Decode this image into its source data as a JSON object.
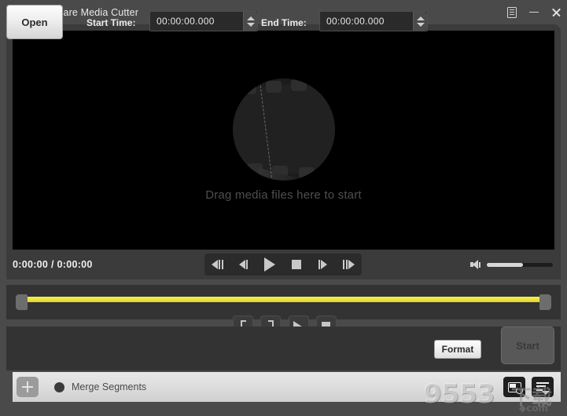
{
  "window": {
    "title": "Joyoshare Media Cutter",
    "logo_icon": "app-logo-icon",
    "menu_icon": "menu-icon",
    "minimize_icon": "minimize-icon",
    "close_icon": "close-icon"
  },
  "player": {
    "drop_hint": "Drag media files here to start",
    "placeholder_icon": "film-reel-icon",
    "time_display": "0:00:00 / 0:00:00",
    "transport": [
      {
        "name": "step-back-fast-button",
        "icon": "skip-back-frames-icon"
      },
      {
        "name": "step-back-button",
        "icon": "step-back-icon"
      },
      {
        "name": "play-button",
        "icon": "play-icon"
      },
      {
        "name": "stop-button",
        "icon": "stop-icon"
      },
      {
        "name": "step-forward-button",
        "icon": "step-forward-icon"
      },
      {
        "name": "step-forward-fast-button",
        "icon": "skip-forward-frames-icon"
      }
    ],
    "volume": {
      "icon": "speaker-icon",
      "level_percent": 55
    }
  },
  "timeline": {
    "left_handle": "trim-start-handle",
    "right_handle": "trim-end-handle",
    "track_color": "#efe33f"
  },
  "trim_controls": [
    {
      "name": "set-start-point-button",
      "icon": "bracket-left-icon"
    },
    {
      "name": "set-end-point-button",
      "icon": "bracket-right-icon"
    },
    {
      "name": "preview-segment-button",
      "icon": "preview-play-icon"
    },
    {
      "name": "stop-preview-button",
      "icon": "stop-square-icon"
    }
  ],
  "edit_bar": {
    "open_label": "Open",
    "start_time_label": "Start Time:",
    "start_time_value": "00:00:00.000",
    "end_time_label": "End Time:",
    "end_time_value": "00:00:00.000",
    "format_label": "Format",
    "start_label": "Start",
    "spinner_up_icon": "chevron-up-icon",
    "spinner_down_icon": "chevron-down-icon"
  },
  "merge_bar": {
    "add_label": "+",
    "add_icon": "plus-icon",
    "toggle_name": "merge-segments-toggle",
    "merge_label": "Merge Segments",
    "output_folder_icon": "output-folder-icon",
    "task_list_icon": "task-list-icon"
  },
  "watermark": {
    "main": "9553",
    "cn": "下载",
    "com": "◆com"
  }
}
